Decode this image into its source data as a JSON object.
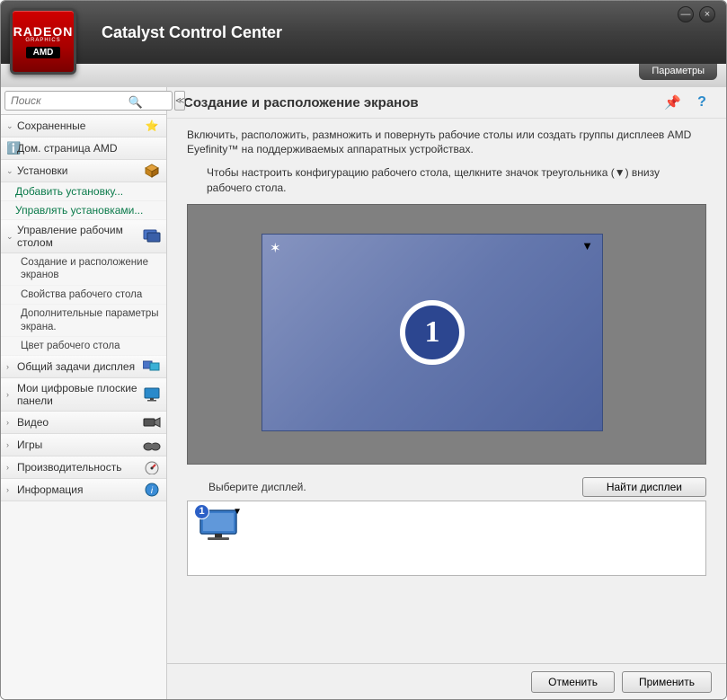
{
  "header": {
    "title": "Catalyst Control Center",
    "logo_brand": "RADEON",
    "logo_sub": "GRAPHICS",
    "logo_vendor": "AMD",
    "params_label": "Параметры"
  },
  "search": {
    "placeholder": "Поиск"
  },
  "sidebar": {
    "saved": "Сохраненные",
    "amd_home": "Дом. страница AMD",
    "installs": "Установки",
    "add_install": "Добавить установку...",
    "manage_installs": "Управлять установками...",
    "desktop_mgmt": "Управление рабочим столом",
    "sub": {
      "create_arrange": "Создание и расположение экранов",
      "desktop_props": "Свойства рабочего стола",
      "extra_params": "Дополнительные параметры экрана.",
      "desktop_color": "Цвет рабочего стола"
    },
    "common_display": "Общий задачи дисплея",
    "my_flat_panels": "Мои цифровые плоские панели",
    "video": "Видео",
    "games": "Игры",
    "performance": "Производительность",
    "information": "Информация"
  },
  "main": {
    "title": "Создание и расположение экранов",
    "description": "Включить, расположить, размножить и повернуть рабочие столы или создать группы дисплеев AMD Eyefinity™ на поддерживаемых аппаратных устройствах.",
    "hint": "Чтобы настроить конфигурацию рабочего стола, щелкните значок треугольника (▼) внизу рабочего стола.",
    "display_number": "1",
    "pick_label": "Выберите дисплей.",
    "find_button": "Найти дисплеи",
    "selector_badge": "1"
  },
  "footer": {
    "cancel": "Отменить",
    "apply": "Применить"
  }
}
